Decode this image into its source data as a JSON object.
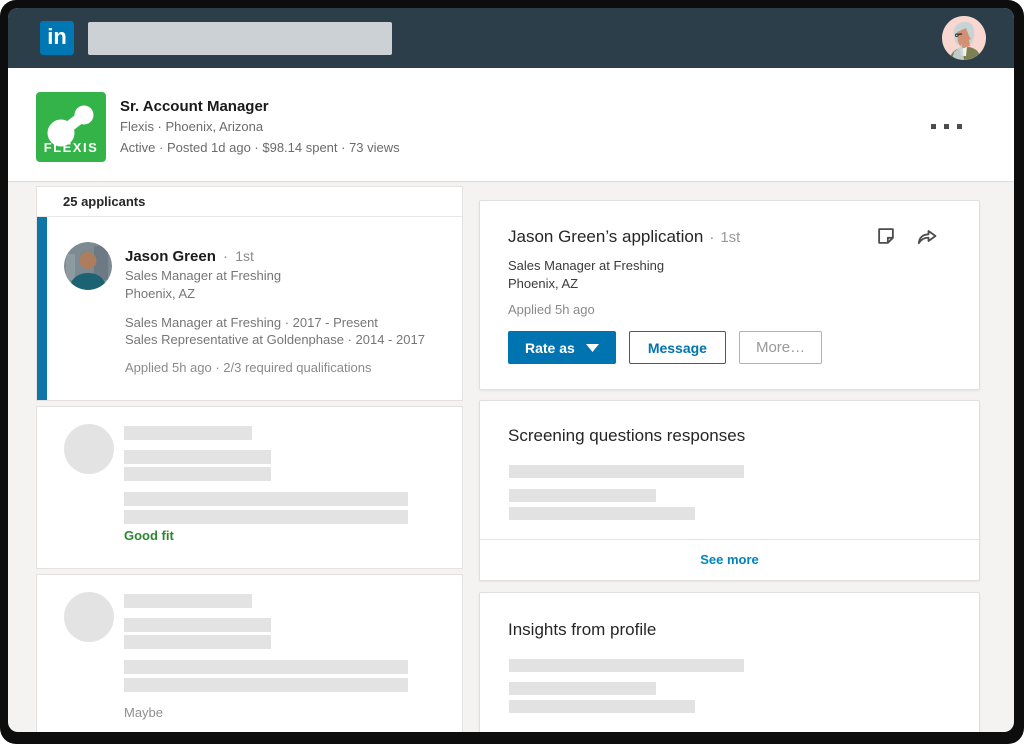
{
  "colors": {
    "navbar": "#2b3e4a",
    "accent_blue": "#0073b1",
    "selected_bar_blue": "#0e76a8",
    "see_more_blue": "#0084bf",
    "good_fit_green": "#2f8632",
    "company_green": "#33b348"
  },
  "navbar": {
    "logo": "in"
  },
  "job_header": {
    "company_logo_text": "FLEXIS",
    "title": "Sr. Account Manager",
    "subtitle": "Flexis · Phoenix, Arizona",
    "meta": "Active · Posted 1d ago · $98.14 spent  · 73 views"
  },
  "applicants": {
    "header": "25 applicants",
    "selected": {
      "name": "Jason Green",
      "dot": "·",
      "degree": "1st",
      "headline": "Sales Manager at Freshing",
      "location": "Phoenix, AZ",
      "experience": [
        "Sales Manager at Freshing  · 2017 - Present",
        "Sales Representative at Goldenphase  · 2014 - 2017"
      ],
      "applied": "Applied 5h ago  · 2/3 required qualifications"
    },
    "placeholders": [
      {
        "label": "Good fit"
      },
      {
        "label": "Maybe"
      }
    ]
  },
  "application": {
    "title": "Jason Green’s application",
    "dot": "·",
    "degree": "1st",
    "headline": "Sales Manager at Freshing",
    "location": "Phoenix, AZ",
    "applied": "Applied 5h ago",
    "buttons": {
      "rate_as": "Rate as",
      "message": "Message",
      "more": "More…"
    }
  },
  "screening": {
    "title": "Screening questions responses",
    "see_more": "See more"
  },
  "insights": {
    "title": "Insights from profile"
  }
}
